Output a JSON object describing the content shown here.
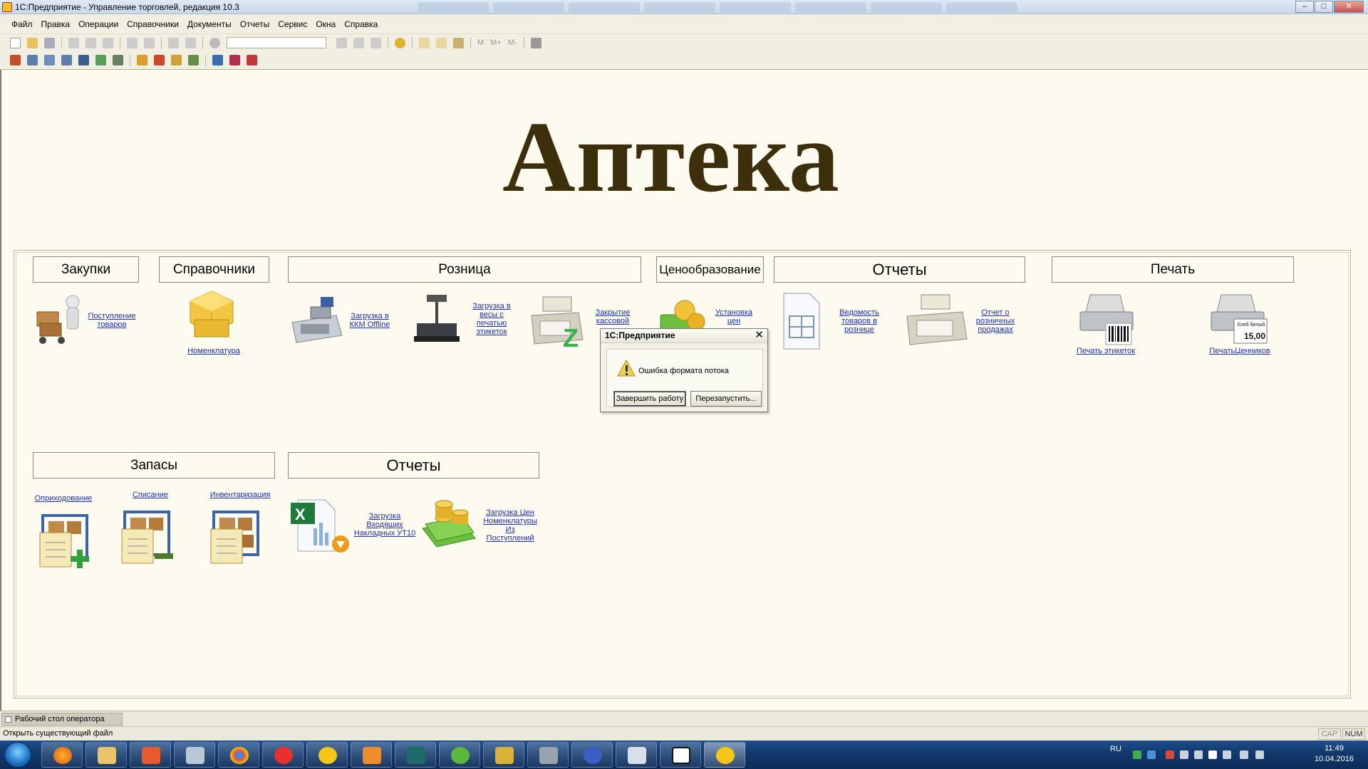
{
  "window": {
    "title": "1С:Предприятие - Управление торговлей, редакция 10.3",
    "minimize": "–",
    "maximize": "□",
    "close": "✕"
  },
  "menu": [
    "Файл",
    "Правка",
    "Операции",
    "Справочники",
    "Документы",
    "Отчеты",
    "Сервис",
    "Окна",
    "Справка"
  ],
  "toolbar": {
    "m_label": "M",
    "mplus_label": "M+",
    "mminus_label": "M-"
  },
  "logo": "Аптека",
  "sections": {
    "purchases": "Закупки",
    "references": "Справочники",
    "retail": "Розница",
    "pricing": "Ценообразование",
    "reports_top": "Отчеты",
    "print": "Печать",
    "stock": "Запасы",
    "reports_bottom": "Отчеты"
  },
  "links": {
    "receipt": "Поступление товаров",
    "nomenclature": "Номенклатура",
    "kkm": "Загрузка в ККМ Offline",
    "scales": "Загрузка в весы с печатью этикеток",
    "close_shift": "Закрытие кассовой",
    "set_prices": "Установка цен",
    "goods_sheet": "Ведомость товаров в рознице",
    "retail_report": "Отчет о розничных продажах",
    "print_labels": "Печать этикеток",
    "print_tags": "ПечатьЦенников",
    "posting": "Оприходование",
    "writeoff": "Списание",
    "inventory": "Инвентаризация",
    "load_invoices": "Загрузка Входящих Накладных УТ10",
    "load_prices": "Загрузка Цен Номенклатуры Из Поступлений"
  },
  "tag_text": {
    "name": "Хлеб белый",
    "price": "15,00"
  },
  "dialog": {
    "title": "1С:Предприятие",
    "message": "Ошибка формата потока",
    "btn_finish": "Завершить работу",
    "btn_restart": "Перезапустить...",
    "close": "✕"
  },
  "window_tab": "Рабочий стол оператора",
  "status": {
    "text": "Открыть существующий файл",
    "cap": "CAP",
    "num": "NUM"
  },
  "taskbar": {
    "lang": "RU",
    "time": "11:49",
    "date": "10.04.2016"
  },
  "colors": {
    "logo": "#3d2f0c",
    "link": "#1c2fbd",
    "desk_bg": "#fdfbf0"
  }
}
